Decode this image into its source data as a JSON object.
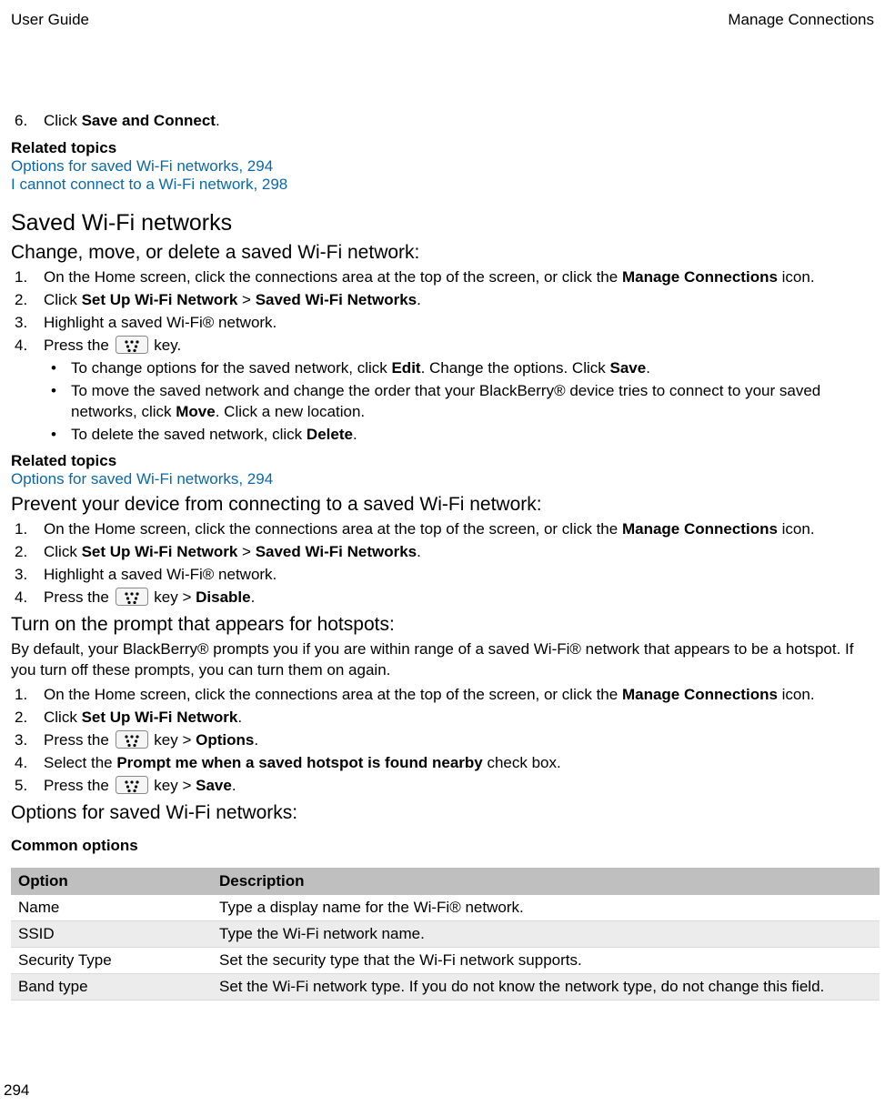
{
  "header": {
    "left": "User Guide",
    "right": "Manage Connections"
  },
  "step6": {
    "num": "6.",
    "prefix": "Click ",
    "bold": "Save and Connect",
    "suffix": "."
  },
  "related1": {
    "title": "Related topics",
    "link1": "Options for saved Wi-Fi networks, 294",
    "link2": "I cannot connect to a Wi-Fi network, 298"
  },
  "h1_saved": "Saved Wi-Fi networks",
  "h2_change": "Change, move, or delete a saved Wi-Fi network:",
  "change_list": {
    "i1": {
      "num": "1.",
      "pre": "On the Home screen, click the connections area at the top of the screen, or click the ",
      "b1": "Manage Connections",
      "post1": " icon."
    },
    "i2": {
      "num": "2.",
      "pre": "Click ",
      "b1": "Set Up Wi-Fi Network",
      "mid": " > ",
      "b2": "Saved Wi-Fi Networks",
      "post": "."
    },
    "i3": {
      "num": "3.",
      "text": "Highlight a saved Wi-Fi® network."
    },
    "i4": {
      "num": "4.",
      "pre": "Press the ",
      "post": " key."
    }
  },
  "change_bullets": {
    "b1": {
      "pre": "To change options for the saved network, click ",
      "bold1": "Edit",
      "mid": ". Change the options. Click ",
      "bold2": "Save",
      "post": "."
    },
    "b2": {
      "pre": "To move the saved network and change the order that your BlackBerry® device tries to connect to your saved networks, click ",
      "bold1": "Move",
      "post": ". Click a new location."
    },
    "b3": {
      "pre": "To delete the saved network, click ",
      "bold1": "Delete",
      "post": "."
    }
  },
  "related2": {
    "title": "Related topics",
    "link1": "Options for saved Wi-Fi networks, 294"
  },
  "h2_prevent": "Prevent your device from connecting to a saved Wi-Fi network:",
  "prevent_list": {
    "i1": {
      "num": "1.",
      "pre": "On the Home screen, click the connections area at the top of the screen, or click the ",
      "b1": "Manage Connections",
      "post1": " icon."
    },
    "i2": {
      "num": "2.",
      "pre": "Click ",
      "b1": "Set Up Wi-Fi Network",
      "mid": " > ",
      "b2": "Saved Wi-Fi Networks",
      "post": "."
    },
    "i3": {
      "num": "3.",
      "text": "Highlight a saved Wi-Fi® network."
    },
    "i4": {
      "num": "4.",
      "pre": "Press the ",
      "mid": " key > ",
      "b1": "Disable",
      "post": "."
    }
  },
  "h2_hotspot": "Turn on the prompt that appears for hotspots:",
  "hotspot_para": "By default, your BlackBerry® prompts you if you are within range of a saved Wi-Fi® network that appears to be a hotspot. If you turn off these prompts, you can turn them on again.",
  "hotspot_list": {
    "i1": {
      "num": "1.",
      "pre": "On the Home screen, click the connections area at the top of the screen, or click the ",
      "b1": "Manage Connections",
      "post1": " icon."
    },
    "i2": {
      "num": "2.",
      "pre": "Click ",
      "b1": "Set Up Wi-Fi Network",
      "post": "."
    },
    "i3": {
      "num": "3.",
      "pre": "Press the ",
      "mid": " key > ",
      "b1": "Options",
      "post": "."
    },
    "i4": {
      "num": "4.",
      "pre": "Select the ",
      "b1": "Prompt me when a saved hotspot is found nearby",
      "post": " check box."
    },
    "i5": {
      "num": "5.",
      "pre": "Press the ",
      "mid": " key > ",
      "b1": "Save",
      "post": "."
    }
  },
  "h2_options": "Options for saved Wi-Fi networks:",
  "common_options_title": "Common options",
  "table": {
    "h1": "Option",
    "h2": "Description",
    "rows": [
      {
        "opt": "Name",
        "desc": "Type a display name for the Wi-Fi® network."
      },
      {
        "opt": "SSID",
        "desc": "Type the Wi-Fi network name."
      },
      {
        "opt": "Security Type",
        "desc": "Set the security type that the Wi-Fi network supports."
      },
      {
        "opt": "Band type",
        "desc": "Set the Wi-Fi network type. If you do not know the network type, do not change this field."
      }
    ]
  },
  "page_number": "294"
}
